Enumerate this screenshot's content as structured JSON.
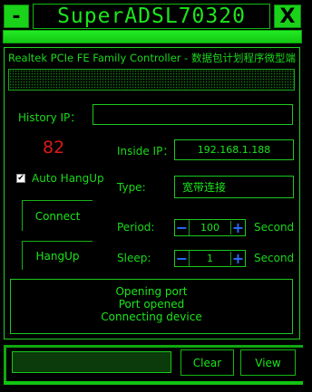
{
  "title_bar": {
    "minimize_label": "-",
    "app_title": "SuperADSL70320",
    "close_label": "X"
  },
  "adapter": {
    "name": "Realtek PCIe FE Family Controller - 数据包计划程序微型端"
  },
  "history_ip": {
    "label": "History IP：",
    "value": ""
  },
  "counter": "82",
  "inside_ip": {
    "label": "Inside IP：",
    "value": "192.168.1.188"
  },
  "auto_hangup": {
    "label": "Auto HangUp",
    "checked": true,
    "check_mark": "✔"
  },
  "type": {
    "label": "Type:",
    "value": "宽带连接"
  },
  "buttons": {
    "connect": "Connect",
    "hangup": "HangUp",
    "clear": "Clear",
    "view": "View"
  },
  "period": {
    "label": "Period:",
    "minus": "−",
    "value": "100",
    "plus": "+",
    "unit": "Second"
  },
  "sleep": {
    "label": "Sleep:",
    "minus": "−",
    "value": "1",
    "plus": "+",
    "unit": "Second"
  },
  "log": {
    "lines": [
      "Opening port",
      "Port opened",
      "Connecting device"
    ]
  },
  "colors": {
    "accent": "#1be61b",
    "counter": "#d91a1a",
    "stepper": "#2b6cff",
    "background": "#000000"
  }
}
